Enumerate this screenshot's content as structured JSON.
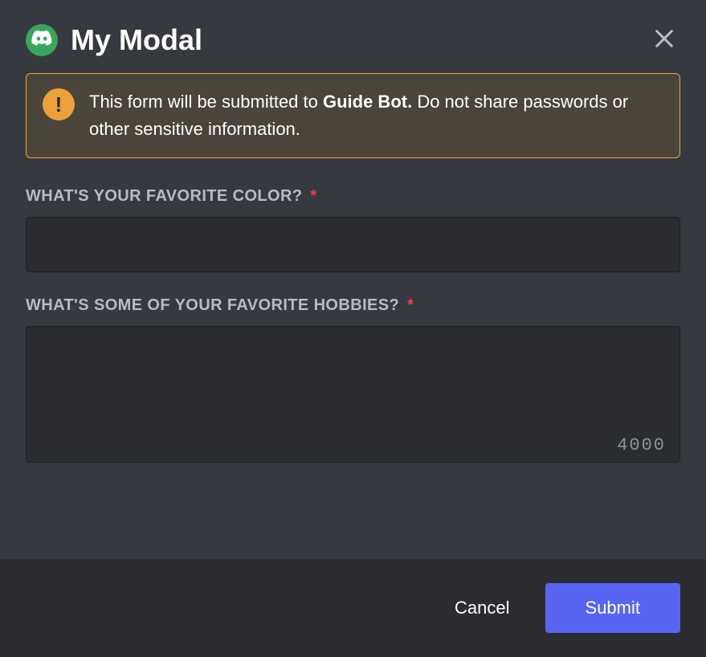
{
  "header": {
    "title": "My Modal"
  },
  "warning": {
    "text_prefix": "This form will be submitted to ",
    "bot_name": "Guide Bot.",
    "text_suffix": " Do not share passwords or other sensitive information."
  },
  "fields": {
    "color": {
      "label": "WHAT'S YOUR FAVORITE COLOR?",
      "value": ""
    },
    "hobbies": {
      "label": "WHAT'S SOME OF YOUR FAVORITE HOBBIES?",
      "value": "",
      "char_limit": "4000"
    }
  },
  "footer": {
    "cancel_label": "Cancel",
    "submit_label": "Submit"
  },
  "required_marker": "*"
}
